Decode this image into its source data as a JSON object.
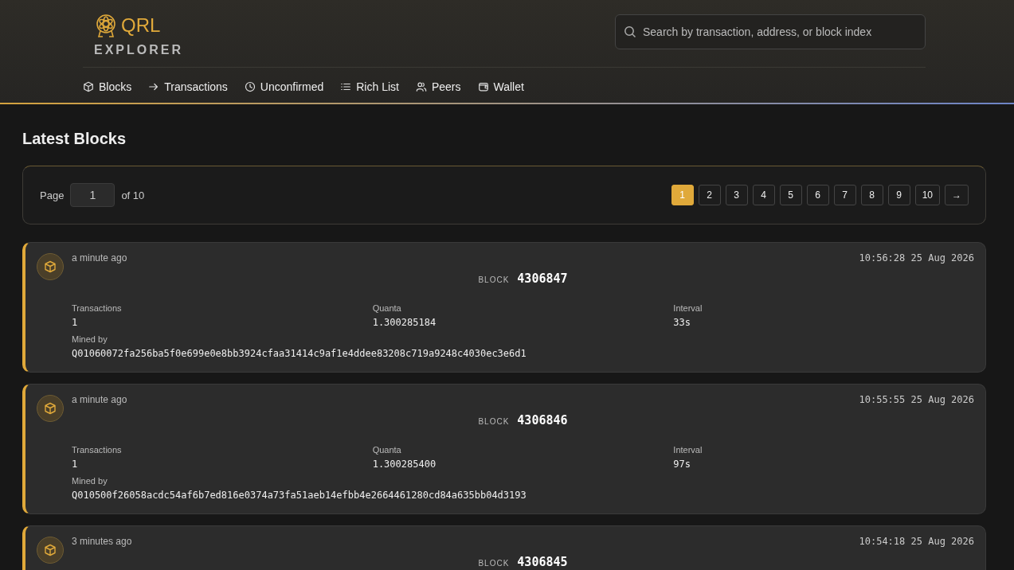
{
  "header": {
    "logo_text": "QRL",
    "subtitle": "EXPLORER",
    "search": {
      "placeholder": "Search by transaction, address, or block index"
    }
  },
  "nav": [
    {
      "label": "Blocks"
    },
    {
      "label": "Transactions"
    },
    {
      "label": "Unconfirmed"
    },
    {
      "label": "Rich List"
    },
    {
      "label": "Peers"
    },
    {
      "label": "Wallet"
    }
  ],
  "title": "Latest Blocks",
  "pagination": {
    "label": "Page",
    "value": "1",
    "of": "of 10",
    "next": "→",
    "pages": [
      {
        "label": "1",
        "selected": true
      },
      {
        "label": "2",
        "selected": false
      },
      {
        "label": "3",
        "selected": false
      },
      {
        "label": "4",
        "selected": false
      },
      {
        "label": "5",
        "selected": false
      },
      {
        "label": "6",
        "selected": false
      },
      {
        "label": "7",
        "selected": false
      },
      {
        "label": "8",
        "selected": false
      },
      {
        "label": "9",
        "selected": false
      },
      {
        "label": "10",
        "selected": false
      }
    ]
  },
  "blocks": [
    {
      "age": "a minute ago",
      "time": "10:56:28 25 Aug 2026",
      "block_label": "BLOCK",
      "number": "4306847",
      "fields": [
        {
          "label": "Transactions",
          "value": "1"
        },
        {
          "label": "Quanta",
          "value": "1.300285184"
        },
        {
          "label": "Interval",
          "value": "33s"
        }
      ],
      "mined_label": "Mined by",
      "miner": "Q01060072fa256ba5f0e699e0e8bb3924cfaa31414c9af1e4ddee83208c719a9248c4030ec3e6d1"
    },
    {
      "age": "a minute ago",
      "time": "10:55:55 25 Aug 2026",
      "block_label": "BLOCK",
      "number": "4306846",
      "fields": [
        {
          "label": "Transactions",
          "value": "1"
        },
        {
          "label": "Quanta",
          "value": "1.300285400"
        },
        {
          "label": "Interval",
          "value": "97s"
        }
      ],
      "mined_label": "Mined by",
      "miner": "Q010500f26058acdc54af6b7ed816e0374a73fa51aeb14efbb4e2664461280cd84a635bb04d3193"
    },
    {
      "age": "3 minutes ago",
      "time": "10:54:18 25 Aug 2026",
      "block_label": "BLOCK",
      "number": "4306845"
    }
  ]
}
